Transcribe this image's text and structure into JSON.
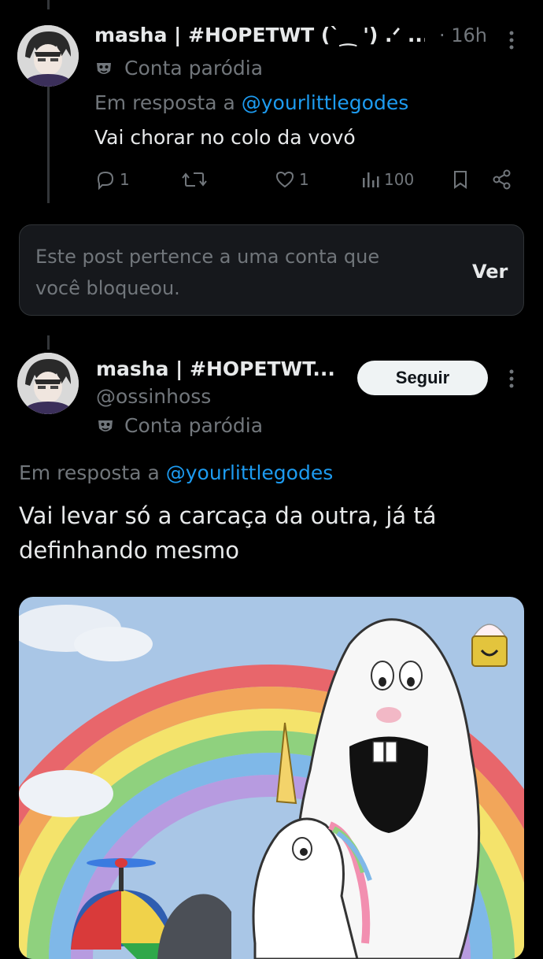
{
  "post1": {
    "name": "masha | #HOPETWT (`⁔ ') .ᐟ ...",
    "time": "· 16h",
    "parody_label": "Conta paródia",
    "reply_prefix": "Em resposta a",
    "reply_handle": "@yourlittlegodes",
    "text": "Vai chorar no colo da vovó",
    "replies": "1",
    "likes": "1",
    "views": "100"
  },
  "blocked_notice": {
    "text_line1": "Este post pertence a uma conta que",
    "text_line2": "você bloqueou.",
    "view_label": "Ver"
  },
  "post2": {
    "name": "masha | #HOPETWT...",
    "handle": "@ossinhoss",
    "parody_label": "Conta paródia",
    "follow_label": "Seguir",
    "reply_prefix": "Em resposta a",
    "reply_handle": "@yourlittlegodes",
    "text_line1": "Vai levar só a carcaça da outra, já tá",
    "text_line2": "definhando mesmo"
  },
  "colors": {
    "background": "#000000",
    "text": "#e7e9ea",
    "muted": "#71767b",
    "link": "#1d9bf0"
  }
}
